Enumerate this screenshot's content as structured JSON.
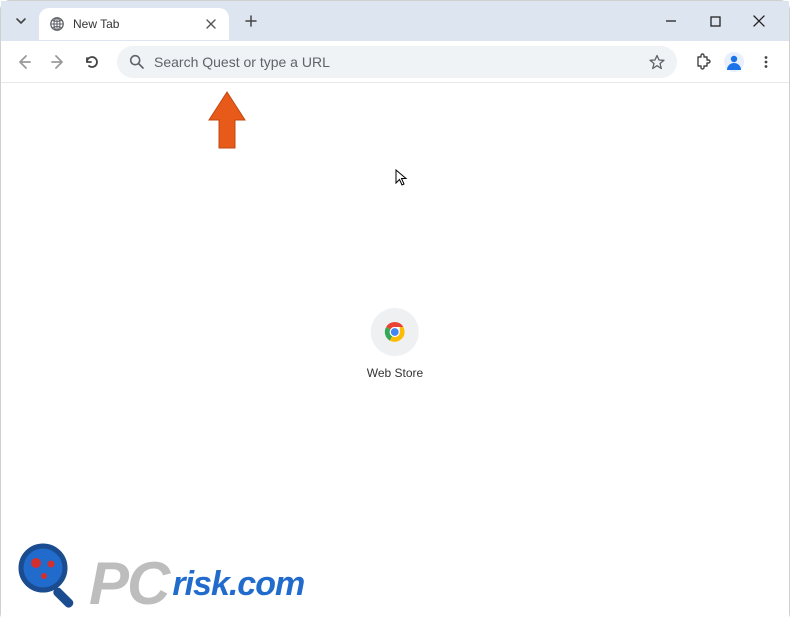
{
  "tab": {
    "title": "New Tab"
  },
  "omnibox": {
    "placeholder": "Search Quest or type a URL"
  },
  "shortcut": {
    "label": "Web Store"
  },
  "watermark": {
    "pc": "PC",
    "risk": "risk.com"
  }
}
